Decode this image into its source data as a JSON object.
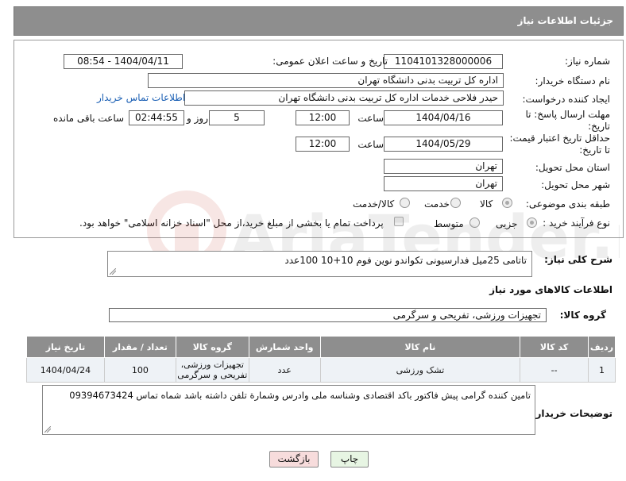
{
  "header": {
    "title": "جزئیات اطلاعات نیاز"
  },
  "form": {
    "need_number_label": "شماره نیاز:",
    "need_number": "1104101328000006",
    "announce_label": "تاریخ و ساعت اعلان عمومی:",
    "announce_value": "1404/04/11 - 08:54",
    "buyer_org_label": "نام دستگاه خریدار:",
    "buyer_org": "اداره کل تربیت بدنی دانشگاه تهران",
    "requester_label": "ایجاد کننده درخواست:",
    "requester": "حیدر فلاحی خدمات اداره کل تربیت بدنی دانشگاه تهران",
    "buyer_contact_link": "اطلاعات تماس خریدار",
    "deadline_label_1": "مهلت ارسال پاسخ: تا",
    "deadline_label_2": "تاریخ:",
    "deadline_date": "1404/04/16",
    "time_label": "ساعت",
    "deadline_time": "12:00",
    "days_value": "5",
    "days_label": "روز و",
    "remaining_time": "02:44:55",
    "remaining_label": "ساعت باقی مانده",
    "validity_label_1": "حداقل تاریخ اعتبار قیمت:",
    "validity_label_2": "تا تاریخ:",
    "validity_date": "1404/05/29",
    "validity_time": "12:00",
    "province_label": "استان محل تحویل:",
    "province": "تهران",
    "city_label": "شهر محل تحویل:",
    "city": "تهران",
    "category_label": "طبقه بندی موضوعی:",
    "category_options": [
      "کالا",
      "خدمت",
      "کالا/خدمت"
    ],
    "process_label": "نوع فرآیند خرید :",
    "process_options": [
      "جزیی",
      "متوسط"
    ],
    "payment_note": "پرداخت تمام یا بخشی از مبلغ خرید،از محل \"اسناد خزانه اسلامی\" خواهد بود."
  },
  "description": {
    "label": "شرح کلی نیاز:",
    "value": "تاتامی 25میل فدارسیونی تکواندو نوین فوم 10+10  100عدد"
  },
  "goods": {
    "section_title": "اطلاعات کالاهای مورد نیاز",
    "group_label": "گروه کالا:",
    "group_value": "تجهیزات ورزشی، تفریحی و سرگرمی",
    "columns": [
      "ردیف",
      "کد کالا",
      "نام کالا",
      "واحد شمارش",
      "گروه کالا",
      "تعداد / مقدار",
      "تاریخ نیاز"
    ],
    "rows": [
      {
        "row": "1",
        "code": "--",
        "name": "تشک ورزشی",
        "unit": "عدد",
        "group_line1": "تجهیزات ورزشی،",
        "group_line2": "تفریحی و سرگرمی",
        "qty": "100",
        "date": "1404/04/24"
      }
    ]
  },
  "buyer_notes": {
    "label": "توضیحات خریدار:",
    "value": "تامین کننده گرامی پیش فاکتور باکد اقتصادی وشناسه ملی وادرس وشمارة تلفن داشته باشد شماه تماس 09394673424"
  },
  "buttons": {
    "print": "چاپ",
    "back": "بازگشت"
  },
  "watermark": {
    "text": "AriaTender.net"
  },
  "colors": {
    "header_bg": "#8e8e8e",
    "link": "#1a5fb4",
    "back_button_bg": "#f7dcdc",
    "print_button_bg": "#e7f5e3"
  }
}
